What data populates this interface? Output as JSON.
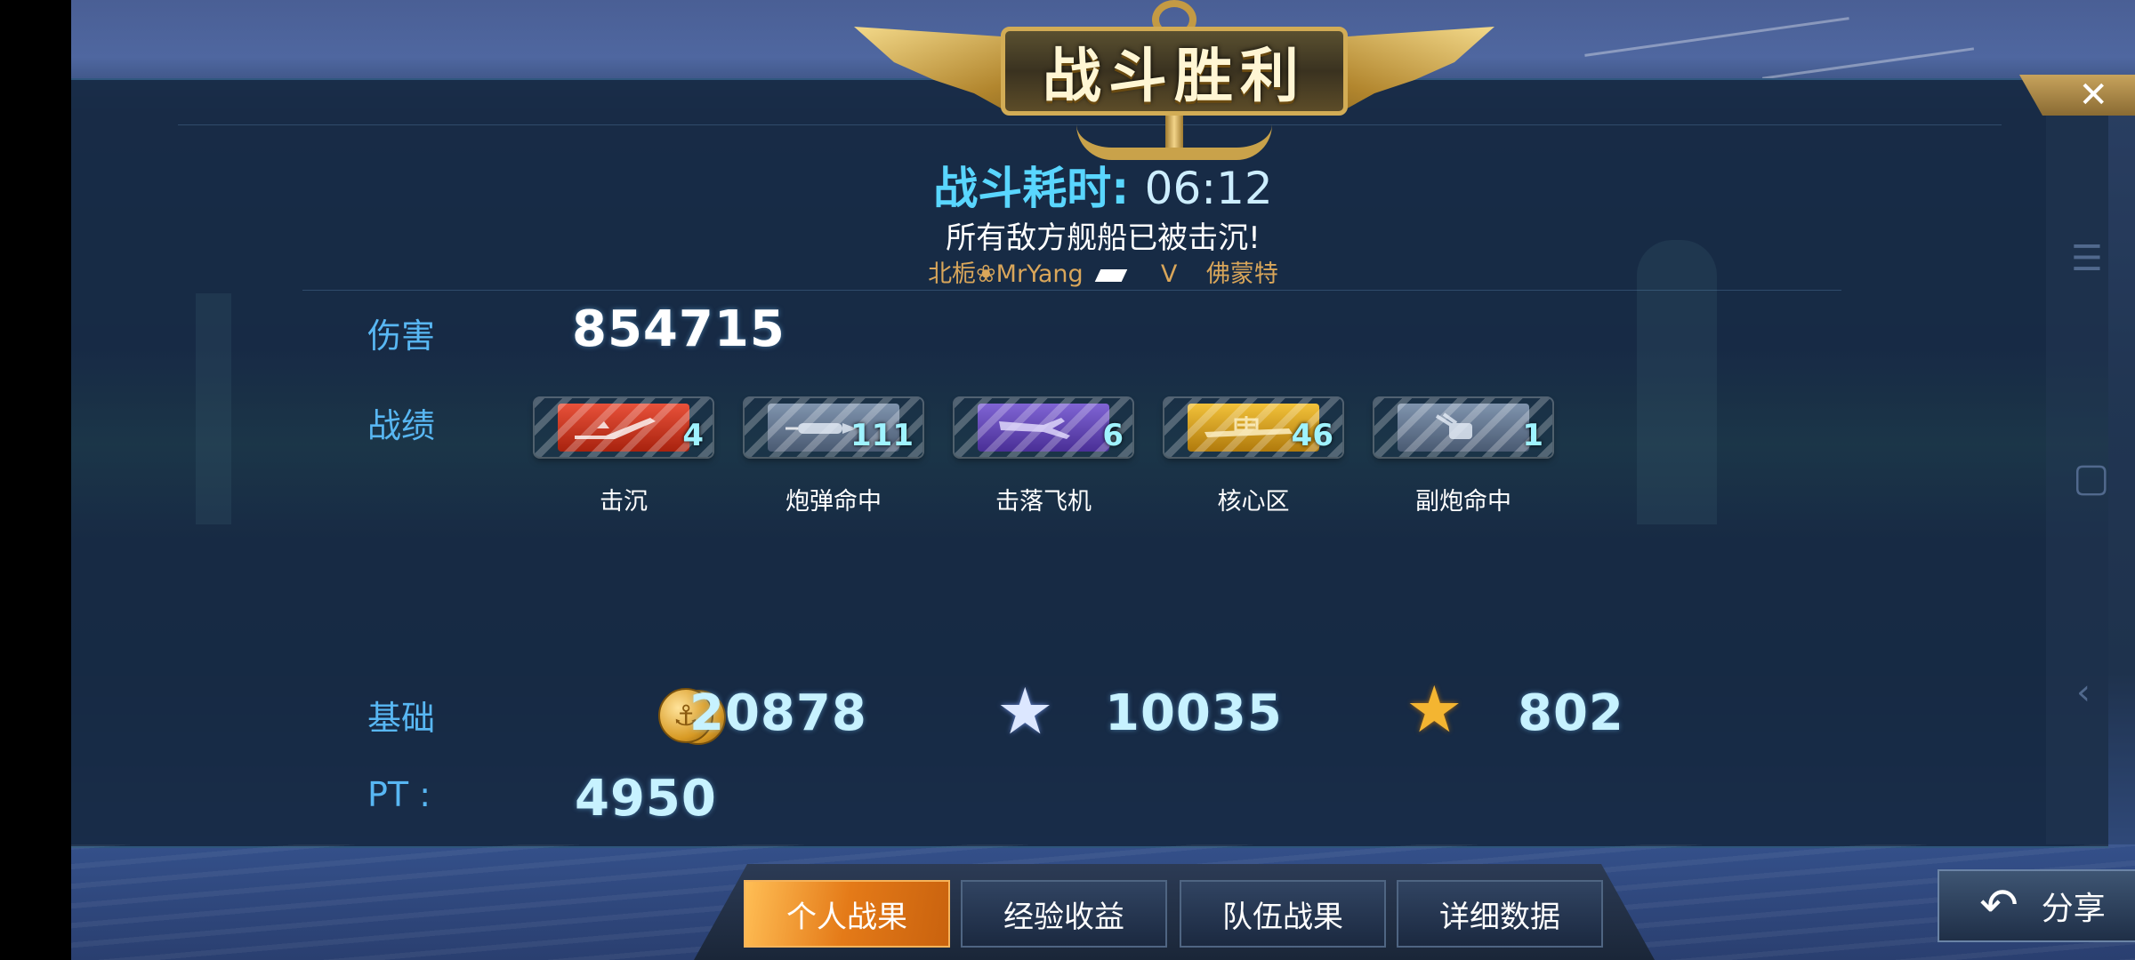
{
  "banner": {
    "title": "战斗胜利"
  },
  "close_icon": "✕",
  "battle": {
    "duration_label": "战斗耗时:",
    "duration_value": "06:12",
    "message": "所有敌方舰船已被击沉!",
    "player": "北栀❀MrYang",
    "vs": "V",
    "opponent": "佛蒙特"
  },
  "damage": {
    "label": "伤害",
    "value": "854715"
  },
  "record": {
    "label": "战绩",
    "medals": [
      {
        "label": "击沉",
        "count": "4",
        "icon": "sinking-ship-icon",
        "color": "#d63a24"
      },
      {
        "label": "炮弹命中",
        "count": "111",
        "icon": "shell-icon",
        "color": "#6b7f9a"
      },
      {
        "label": "击落飞机",
        "count": "6",
        "icon": "aircraft-icon",
        "color": "#6a4fb8"
      },
      {
        "label": "核心区",
        "count": "46",
        "icon": "citadel-icon",
        "color": "#d9a21c"
      },
      {
        "label": "副炮命中",
        "count": "1",
        "icon": "secondary-gun-icon",
        "color": "#6b7f9a"
      }
    ]
  },
  "base": {
    "label": "基础",
    "coins": "20878",
    "silver_star": "10035",
    "gold_star": "802"
  },
  "pt": {
    "label": "PT :",
    "value": "4950"
  },
  "tabs": [
    "个人战果",
    "经验收益",
    "队伍战果",
    "详细数据"
  ],
  "share": {
    "label": "分享"
  },
  "colors": {
    "accent_blue": "#58b7f3",
    "active_tab": "#e47a18",
    "gold": "#d2ac55"
  }
}
